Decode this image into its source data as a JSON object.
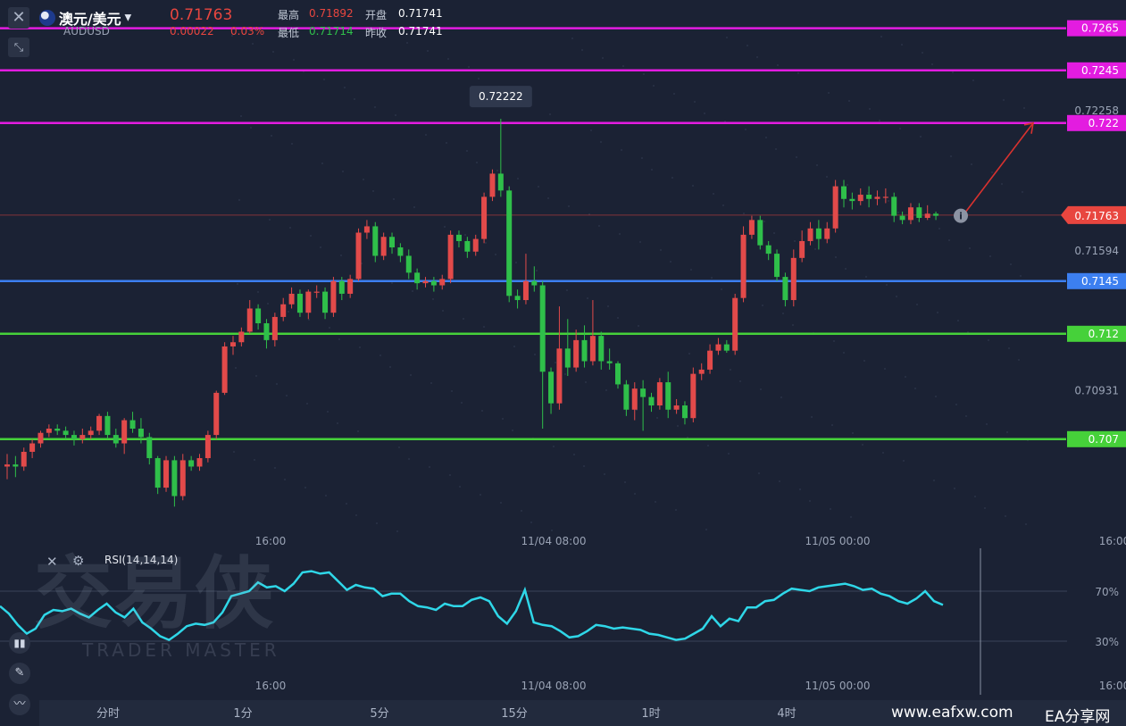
{
  "header": {
    "symbol_name": "澳元/美元",
    "symbol_code": "AUDUSD",
    "price": "0.71763",
    "change": "0.00022",
    "change_pct": "0.03%",
    "high_label": "最高",
    "high_value": "0.71892",
    "low_label": "最低",
    "low_value": "0.71714",
    "open_label": "开盘",
    "open_value": "0.71741",
    "prev_close_label": "昨收",
    "prev_close_value": "0.71741"
  },
  "colors": {
    "up": "#e24a4a",
    "down": "#2fbf4a",
    "magenta": "#e31ce0",
    "blue": "#3c7ff0",
    "green": "#46d13a",
    "rsi": "#2fd7e8",
    "price_tag": "#e8463f"
  },
  "chart_data": {
    "type": "candlestick",
    "y_ticks": [
      "0.72258",
      "0.71594",
      "0.70931"
    ],
    "ylim": [
      0.7025,
      0.7275
    ],
    "x_ticks": [
      "16:00",
      "11/04 08:00",
      "11/05 00:00",
      "16:00"
    ],
    "peak_label": "0.72222",
    "current_price": "0.71763",
    "horizontal_levels": [
      {
        "value": 0.7265,
        "label": "0.7265",
        "color": "#e31ce0"
      },
      {
        "value": 0.7245,
        "label": "0.7245",
        "color": "#e31ce0"
      },
      {
        "value": 0.722,
        "label": "0.722",
        "color": "#e31ce0"
      },
      {
        "value": 0.7145,
        "label": "0.7145",
        "color": "#3c7ff0"
      },
      {
        "value": 0.712,
        "label": "0.712",
        "color": "#46d13a"
      },
      {
        "value": 0.707,
        "label": "0.707",
        "color": "#46d13a"
      }
    ],
    "candles": [
      [
        0.7057,
        0.7058,
        0.7063,
        0.7051
      ],
      [
        0.7058,
        0.7057,
        0.7062,
        0.7052
      ],
      [
        0.7057,
        0.7064,
        0.7066,
        0.7055
      ],
      [
        0.7064,
        0.7068,
        0.707,
        0.7061
      ],
      [
        0.7068,
        0.7073,
        0.7074,
        0.7066
      ],
      [
        0.7073,
        0.7075,
        0.7077,
        0.7071
      ],
      [
        0.7075,
        0.7074,
        0.7077,
        0.7072
      ],
      [
        0.7074,
        0.7072,
        0.7076,
        0.707
      ],
      [
        0.7072,
        0.707,
        0.7074,
        0.7067
      ],
      [
        0.707,
        0.7072,
        0.7075,
        0.7068
      ],
      [
        0.7072,
        0.7074,
        0.7076,
        0.707
      ],
      [
        0.7074,
        0.7081,
        0.7082,
        0.7072
      ],
      [
        0.7081,
        0.7072,
        0.7083,
        0.707
      ],
      [
        0.7072,
        0.7068,
        0.7075,
        0.7066
      ],
      [
        0.7068,
        0.7079,
        0.708,
        0.7063
      ],
      [
        0.7079,
        0.7075,
        0.7083,
        0.7073
      ],
      [
        0.7075,
        0.7071,
        0.708,
        0.7068
      ],
      [
        0.7071,
        0.7061,
        0.7073,
        0.7058
      ],
      [
        0.7061,
        0.7047,
        0.7062,
        0.7044
      ],
      [
        0.7047,
        0.706,
        0.7062,
        0.7045
      ],
      [
        0.706,
        0.7043,
        0.7062,
        0.7038
      ],
      [
        0.7043,
        0.706,
        0.7063,
        0.7041
      ],
      [
        0.706,
        0.7057,
        0.7062,
        0.7055
      ],
      [
        0.7057,
        0.7061,
        0.7063,
        0.7055
      ],
      [
        0.7061,
        0.7072,
        0.7074,
        0.7059
      ],
      [
        0.7072,
        0.7092,
        0.7093,
        0.707
      ],
      [
        0.7092,
        0.7114,
        0.7116,
        0.7091
      ],
      [
        0.7114,
        0.7116,
        0.7119,
        0.711
      ],
      [
        0.7116,
        0.7121,
        0.7123,
        0.7114
      ],
      [
        0.7121,
        0.7132,
        0.7136,
        0.712
      ],
      [
        0.7132,
        0.7125,
        0.7134,
        0.7122
      ],
      [
        0.7125,
        0.7117,
        0.7127,
        0.7113
      ],
      [
        0.7117,
        0.7128,
        0.713,
        0.7114
      ],
      [
        0.7128,
        0.7134,
        0.7137,
        0.7126
      ],
      [
        0.7134,
        0.7139,
        0.7142,
        0.7132
      ],
      [
        0.7139,
        0.713,
        0.7141,
        0.7128
      ],
      [
        0.713,
        0.714,
        0.7141,
        0.7127
      ],
      [
        0.714,
        0.714,
        0.7143,
        0.7137
      ],
      [
        0.714,
        0.713,
        0.7142,
        0.7127
      ],
      [
        0.713,
        0.7145,
        0.7147,
        0.7128
      ],
      [
        0.7145,
        0.7139,
        0.7147,
        0.7136
      ],
      [
        0.7139,
        0.7146,
        0.7148,
        0.7137
      ],
      [
        0.7146,
        0.7168,
        0.717,
        0.7145
      ],
      [
        0.7168,
        0.7171,
        0.7174,
        0.7165
      ],
      [
        0.7171,
        0.7157,
        0.7173,
        0.7154
      ],
      [
        0.7157,
        0.7166,
        0.7168,
        0.7155
      ],
      [
        0.7166,
        0.7161,
        0.7168,
        0.7158
      ],
      [
        0.7161,
        0.7157,
        0.7163,
        0.7154
      ],
      [
        0.7157,
        0.7149,
        0.716,
        0.7146
      ],
      [
        0.7149,
        0.7144,
        0.7151,
        0.7141
      ],
      [
        0.7144,
        0.7145,
        0.7147,
        0.7142
      ],
      [
        0.7145,
        0.7143,
        0.7147,
        0.714
      ],
      [
        0.7143,
        0.7146,
        0.7148,
        0.7141
      ],
      [
        0.7146,
        0.7167,
        0.7169,
        0.7144
      ],
      [
        0.7167,
        0.7164,
        0.7169,
        0.7161
      ],
      [
        0.7164,
        0.7159,
        0.7166,
        0.7156
      ],
      [
        0.7159,
        0.7165,
        0.7167,
        0.7157
      ],
      [
        0.7165,
        0.7185,
        0.7187,
        0.7163
      ],
      [
        0.7185,
        0.7196,
        0.7198,
        0.7183
      ],
      [
        0.7196,
        0.7188,
        0.7222,
        0.7185
      ],
      [
        0.7188,
        0.7138,
        0.719,
        0.7135
      ],
      [
        0.7138,
        0.7136,
        0.7141,
        0.7132
      ],
      [
        0.7136,
        0.7145,
        0.7158,
        0.7134
      ],
      [
        0.7145,
        0.7143,
        0.7152,
        0.714
      ],
      [
        0.7143,
        0.7102,
        0.7145,
        0.7075
      ],
      [
        0.7102,
        0.7087,
        0.7104,
        0.7082
      ],
      [
        0.7087,
        0.7113,
        0.7133,
        0.7084
      ],
      [
        0.7113,
        0.7104,
        0.7127,
        0.71
      ],
      [
        0.7104,
        0.7117,
        0.7122,
        0.7102
      ],
      [
        0.7117,
        0.7107,
        0.7124,
        0.7104
      ],
      [
        0.7107,
        0.7119,
        0.7136,
        0.7105
      ],
      [
        0.7119,
        0.7107,
        0.7121,
        0.7103
      ],
      [
        0.7107,
        0.7106,
        0.7113,
        0.7103
      ],
      [
        0.7106,
        0.7096,
        0.7107,
        0.7094
      ],
      [
        0.7096,
        0.7084,
        0.7098,
        0.7081
      ],
      [
        0.7084,
        0.7094,
        0.7097,
        0.7079
      ],
      [
        0.7094,
        0.709,
        0.7098,
        0.7074
      ],
      [
        0.709,
        0.7086,
        0.7092,
        0.7083
      ],
      [
        0.7086,
        0.7097,
        0.7099,
        0.7084
      ],
      [
        0.7097,
        0.7084,
        0.7102,
        0.708
      ],
      [
        0.7084,
        0.7086,
        0.7089,
        0.7082
      ],
      [
        0.7086,
        0.708,
        0.7088,
        0.7077
      ],
      [
        0.708,
        0.7101,
        0.7104,
        0.7078
      ],
      [
        0.7101,
        0.7103,
        0.7106,
        0.7098
      ],
      [
        0.7103,
        0.7112,
        0.7115,
        0.7101
      ],
      [
        0.7112,
        0.7115,
        0.7118,
        0.711
      ],
      [
        0.7115,
        0.7112,
        0.7117,
        0.7111
      ],
      [
        0.7112,
        0.7137,
        0.7139,
        0.711
      ],
      [
        0.7137,
        0.7167,
        0.7171,
        0.7135
      ],
      [
        0.7167,
        0.7174,
        0.7176,
        0.7165
      ],
      [
        0.7174,
        0.7162,
        0.7176,
        0.716
      ],
      [
        0.7162,
        0.7158,
        0.7164,
        0.7155
      ],
      [
        0.7158,
        0.7147,
        0.716,
        0.7145
      ],
      [
        0.7147,
        0.7136,
        0.7149,
        0.7133
      ],
      [
        0.7136,
        0.7156,
        0.716,
        0.7133
      ],
      [
        0.7156,
        0.7164,
        0.7169,
        0.7154
      ],
      [
        0.7164,
        0.717,
        0.7173,
        0.7162
      ],
      [
        0.717,
        0.7165,
        0.7174,
        0.716
      ],
      [
        0.7165,
        0.717,
        0.7173,
        0.7163
      ],
      [
        0.717,
        0.719,
        0.7193,
        0.7168
      ],
      [
        0.719,
        0.7184,
        0.7193,
        0.718
      ],
      [
        0.7184,
        0.7183,
        0.7187,
        0.7179
      ],
      [
        0.7183,
        0.7186,
        0.7189,
        0.7181
      ],
      [
        0.7186,
        0.7184,
        0.719,
        0.718
      ],
      [
        0.7184,
        0.7185,
        0.7188,
        0.7181
      ],
      [
        0.7185,
        0.7185,
        0.7189,
        0.7182
      ],
      [
        0.7185,
        0.7176,
        0.7187,
        0.7173
      ],
      [
        0.7176,
        0.7174,
        0.7178,
        0.7172
      ],
      [
        0.7174,
        0.718,
        0.7182,
        0.7172
      ],
      [
        0.718,
        0.7175,
        0.7182,
        0.7173
      ],
      [
        0.7175,
        0.7177,
        0.7181,
        0.7174
      ],
      [
        0.7177,
        0.7176,
        0.7178,
        0.7174
      ]
    ],
    "rsi": {
      "label": "RSI(14,14,14)",
      "levels": [
        "70%",
        "30%"
      ],
      "x_ticks": [
        "16:00",
        "11/04 08:00",
        "11/05 00:00",
        "16:00"
      ],
      "values": [
        58,
        52,
        43,
        36,
        40,
        51,
        55,
        54,
        56,
        52,
        49,
        55,
        60,
        53,
        49,
        56,
        45,
        40,
        34,
        31,
        36,
        42,
        44,
        43,
        45,
        53,
        66,
        68,
        70,
        77,
        73,
        74,
        70,
        76,
        85,
        86,
        84,
        85,
        78,
        71,
        75,
        73,
        72,
        66,
        68,
        68,
        62,
        58,
        57,
        55,
        60,
        58,
        58,
        63,
        65,
        62,
        50,
        44,
        54,
        71,
        45,
        43,
        42,
        38,
        33,
        34,
        38,
        43,
        42,
        40,
        41,
        40,
        39,
        36,
        35,
        33,
        31,
        32,
        36,
        40,
        50,
        42,
        48,
        46,
        57,
        57,
        62,
        63,
        68,
        72,
        71,
        70,
        73,
        74,
        75,
        76,
        74,
        71,
        72,
        68,
        66,
        62,
        60,
        64,
        70,
        62,
        59
      ]
    },
    "arrow": {
      "from": 0.7177,
      "to": 0.722
    }
  },
  "timeframes": [
    "分时",
    "1分",
    "5分",
    "15分",
    "1时",
    "4时"
  ],
  "watermark": {
    "chinese": "交易侠",
    "english": "TRADER MASTER",
    "site": "www.eafxw.com",
    "site_name": "EA分享网"
  }
}
